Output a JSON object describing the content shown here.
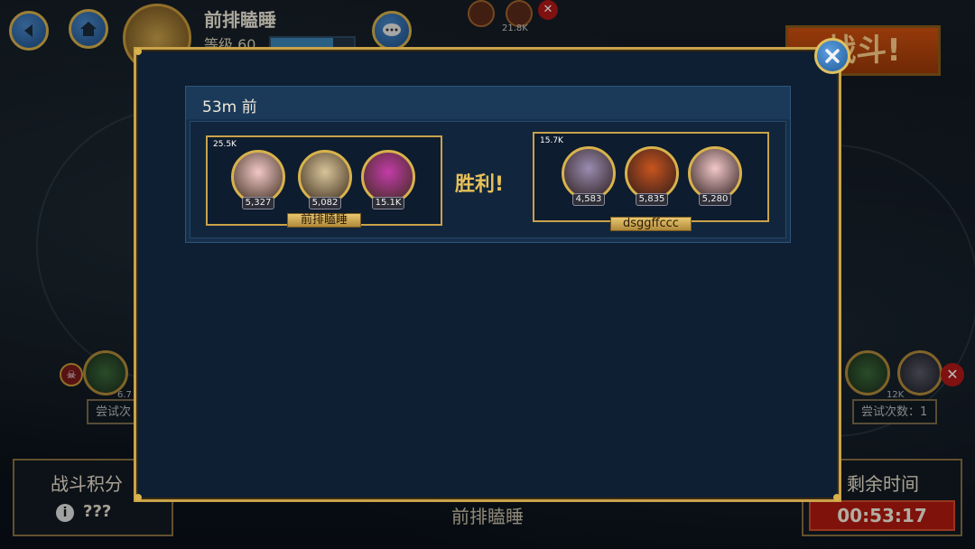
{
  "top_bar": {
    "player_name": "前排瞌睡",
    "level_label": "等级 60",
    "xp_fill": 0.75,
    "back_icon": "back-arrow-icon",
    "home_icon": "home-icon",
    "chat_icon": "chat-bubble-icon"
  },
  "top_opponent": {
    "power": "21.8K"
  },
  "fight_button": {
    "label": "战斗!"
  },
  "left_challenger": {
    "power": "6.7",
    "attempts_label": "尝试次"
  },
  "right_challenger": {
    "power": "12K",
    "attempts_label": "尝试次数：1"
  },
  "score_panel": {
    "title": "战斗积分",
    "value": "???"
  },
  "time_panel": {
    "title": "剩余时间",
    "value": "00:53:17"
  },
  "bottom_name": "前排瞌睡",
  "modal": {
    "entry_time": "53m  前",
    "result": "胜利!",
    "player_team": {
      "name": "前排瞌睡",
      "team_power": "25.5K",
      "heroes": [
        {
          "power": "5,327",
          "color": "#f2c8c8"
        },
        {
          "power": "5,082",
          "color": "#d8c49a"
        },
        {
          "power": "15.1K",
          "color": "#c23ca8"
        }
      ]
    },
    "enemy_team": {
      "name": "dsggffccc",
      "team_power": "15.7K",
      "heroes": [
        {
          "power": "4,583",
          "color": "#9a8cb0"
        },
        {
          "power": "5,835",
          "color": "#c8541e"
        },
        {
          "power": "5,280",
          "color": "#f2c8c8"
        }
      ]
    }
  },
  "colors": {
    "gold": "#c9a24a",
    "panel": "#0e1e33",
    "result": "#e8c058",
    "timer_red": "#b01a10"
  }
}
